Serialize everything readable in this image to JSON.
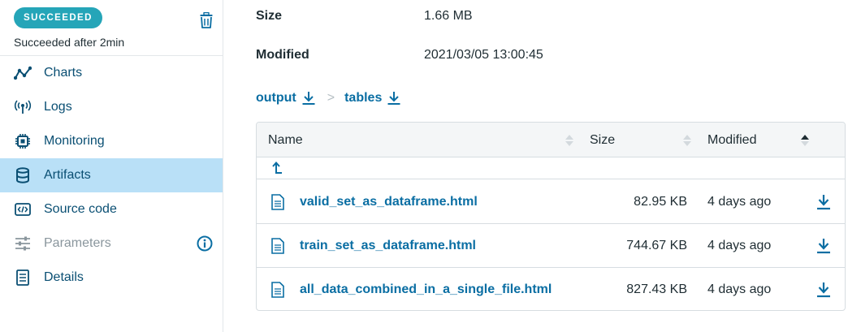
{
  "status": {
    "badge": "SUCCEEDED",
    "text": "Succeeded after 2min"
  },
  "sidebar": {
    "items": [
      {
        "label": "Charts",
        "icon": "chart-line-icon"
      },
      {
        "label": "Logs",
        "icon": "broadcast-icon"
      },
      {
        "label": "Monitoring",
        "icon": "chip-icon"
      },
      {
        "label": "Artifacts",
        "icon": "database-icon",
        "active": true
      },
      {
        "label": "Source code",
        "icon": "code-icon"
      },
      {
        "label": "Parameters",
        "icon": "sliders-icon",
        "disabled": true
      },
      {
        "label": "Details",
        "icon": "document-list-icon"
      }
    ]
  },
  "meta": {
    "size_label": "Size",
    "size_value": "1.66 MB",
    "modified_label": "Modified",
    "modified_value": "2021/03/05 13:00:45"
  },
  "breadcrumb": {
    "items": [
      "output",
      "tables"
    ],
    "separator": ">"
  },
  "table": {
    "columns": {
      "name": "Name",
      "size": "Size",
      "modified": "Modified"
    },
    "rows": [
      {
        "name": "valid_set_as_dataframe.html",
        "size": "82.95 KB",
        "modified": "4 days ago"
      },
      {
        "name": "train_set_as_dataframe.html",
        "size": "744.67 KB",
        "modified": "4 days ago"
      },
      {
        "name": "all_data_combined_in_a_single_file.html",
        "size": "827.43 KB",
        "modified": "4 days ago"
      }
    ]
  },
  "colors": {
    "accent": "#0a6ea3",
    "badge": "#25a5b8",
    "active_nav": "#b9e0f7",
    "nav_text": "#0a4f73"
  }
}
